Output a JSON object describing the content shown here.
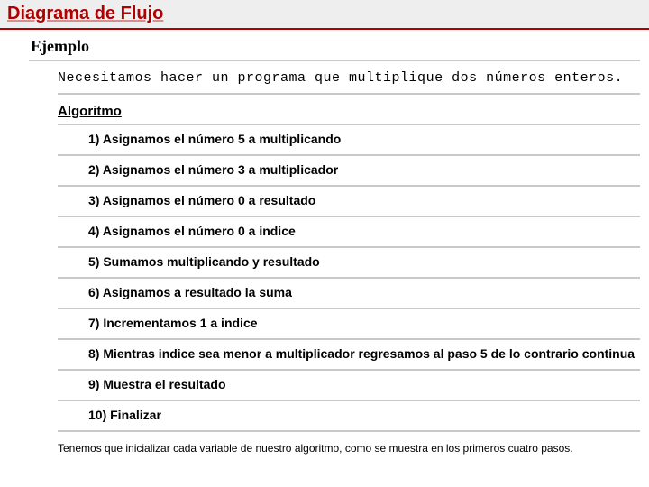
{
  "title": "Diagrama de Flujo",
  "example_label": "Ejemplo",
  "description": "Necesitamos hacer un programa que multiplique dos números enteros.",
  "algorithm_label": "Algoritmo",
  "steps": [
    "1) Asignamos el número 5 a multiplicando",
    "2) Asignamos el número 3 a multiplicador",
    "3) Asignamos el número 0 a resultado",
    "4) Asignamos el número 0 a indice",
    "5) Sumamos multiplicando y resultado",
    "6) Asignamos a resultado la suma",
    "7) Incrementamos 1 a indice",
    "8) Mientras indice sea menor a multiplicador regresamos al paso 5 de lo contrario continua",
    "9) Muestra el resultado",
    "10) Finalizar"
  ],
  "footer_note": "Tenemos que inicializar cada variable de nuestro algoritmo, como se muestra en los primeros cuatro pasos."
}
